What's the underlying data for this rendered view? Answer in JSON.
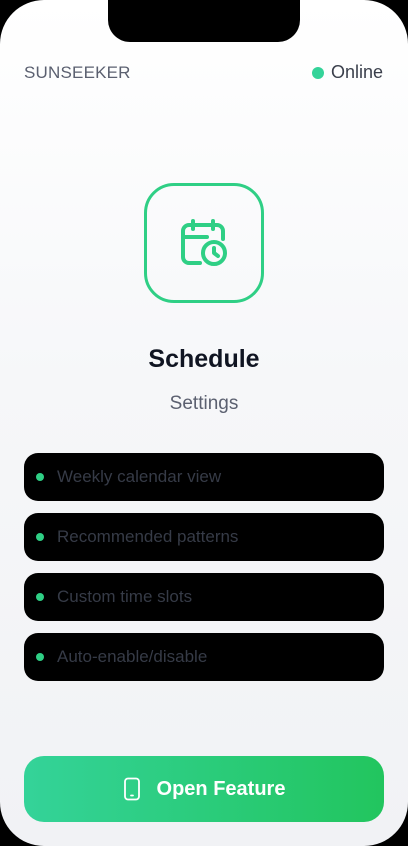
{
  "header": {
    "brand": "SUNSEEKER",
    "status_text": "Online",
    "status_color": "#34d399"
  },
  "feature": {
    "icon": "calendar-clock-icon",
    "title": "Schedule",
    "subtitle": "Settings"
  },
  "features_list": [
    {
      "label": "Weekly calendar view"
    },
    {
      "label": "Recommended patterns"
    },
    {
      "label": "Custom time slots"
    },
    {
      "label": "Auto-enable/disable"
    }
  ],
  "action": {
    "icon": "phone-icon",
    "label": "Open Feature"
  },
  "colors": {
    "accent": "#2fcf85",
    "button_gradient_start": "#34d399",
    "button_gradient_end": "#22c55e"
  }
}
